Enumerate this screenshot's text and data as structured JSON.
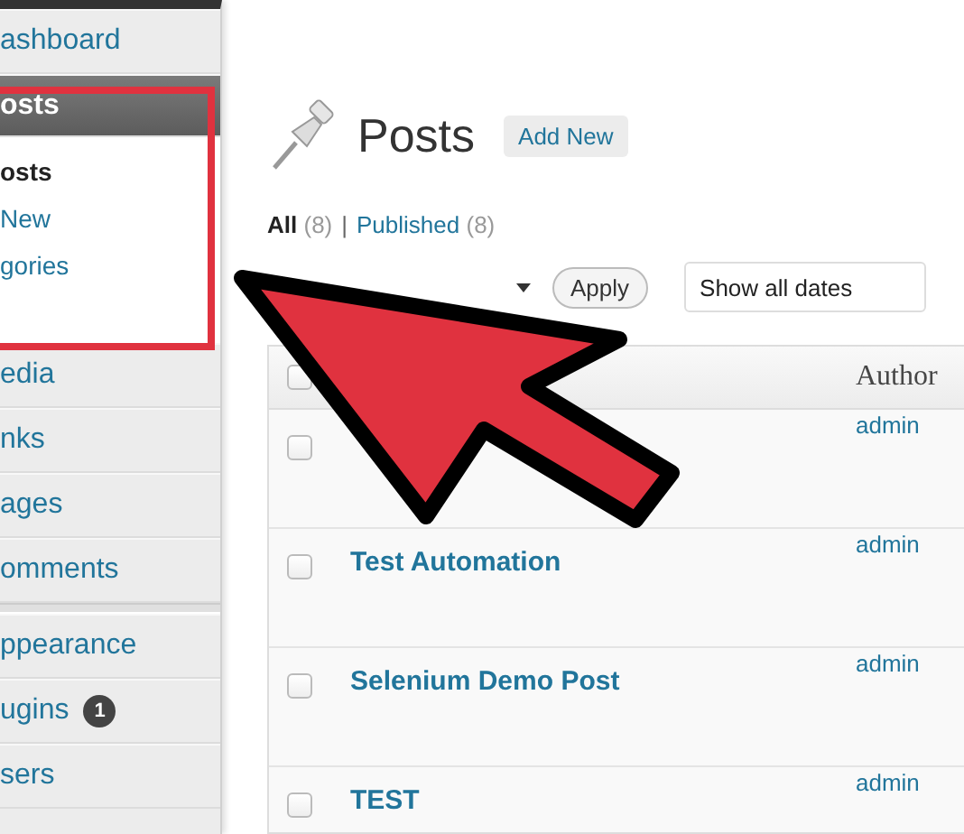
{
  "sidebar": {
    "groups": [
      [
        {
          "label": "ashboard",
          "selected": false
        },
        {
          "label": "osts",
          "selected": true,
          "children": [
            {
              "label": "osts",
              "selected": true
            },
            {
              "label": "New",
              "selected": false
            },
            {
              "label": "gories",
              "selected": false
            }
          ]
        },
        {
          "label": "edia",
          "selected": false
        },
        {
          "label": "nks",
          "selected": false
        },
        {
          "label": "ages",
          "selected": false
        },
        {
          "label": "omments",
          "selected": false
        }
      ],
      [
        {
          "label": "ppearance",
          "selected": false
        },
        {
          "label": "ugins",
          "selected": false,
          "badge": "1"
        },
        {
          "label": "sers",
          "selected": false
        }
      ]
    ]
  },
  "main": {
    "title": "Posts",
    "add_new": "Add New",
    "filters": [
      {
        "label": "All",
        "count": "(8)",
        "selected": true
      },
      {
        "label": "Published",
        "count": "(8)",
        "selected": false
      }
    ],
    "filter_separator": "|",
    "apply": "Apply",
    "date_filter": "Show all dates",
    "table": {
      "header_checkbox": {
        "checked": false
      },
      "columns": [
        "Author"
      ],
      "rows": [
        {
          "checked": false,
          "author": "admin"
        },
        {
          "title": "Test Automation",
          "checked": false,
          "author": "admin"
        },
        {
          "title": "Selenium Demo Post",
          "checked": false,
          "author": "admin"
        },
        {
          "title": "TEST",
          "checked": false,
          "author": "admin"
        }
      ]
    }
  }
}
